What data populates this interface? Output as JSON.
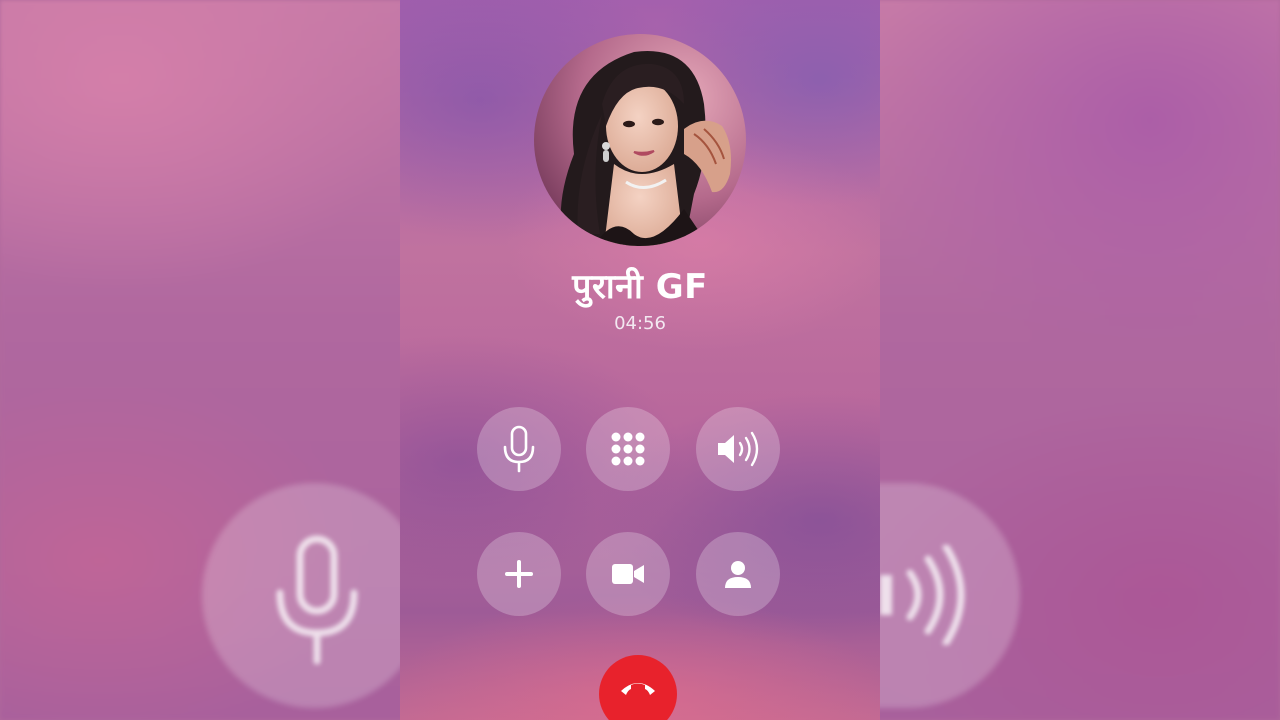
{
  "call": {
    "caller_name": "पुरानी GF",
    "duration": "04:56"
  },
  "controls": {
    "row1": [
      {
        "name": "mute",
        "icon": "microphone-icon"
      },
      {
        "name": "keypad",
        "icon": "keypad-icon"
      },
      {
        "name": "speaker",
        "icon": "speaker-icon"
      }
    ],
    "row2": [
      {
        "name": "add-call",
        "icon": "plus-icon"
      },
      {
        "name": "video-call",
        "icon": "video-camera-icon"
      },
      {
        "name": "contacts",
        "icon": "person-icon"
      }
    ],
    "end_call": {
      "icon": "phone-hangup-icon",
      "color": "#e8222c"
    }
  },
  "colors": {
    "accent_end_call": "#e8222c",
    "text": "#ffffff",
    "button_fill": "rgba(255,255,255,0.24)"
  }
}
